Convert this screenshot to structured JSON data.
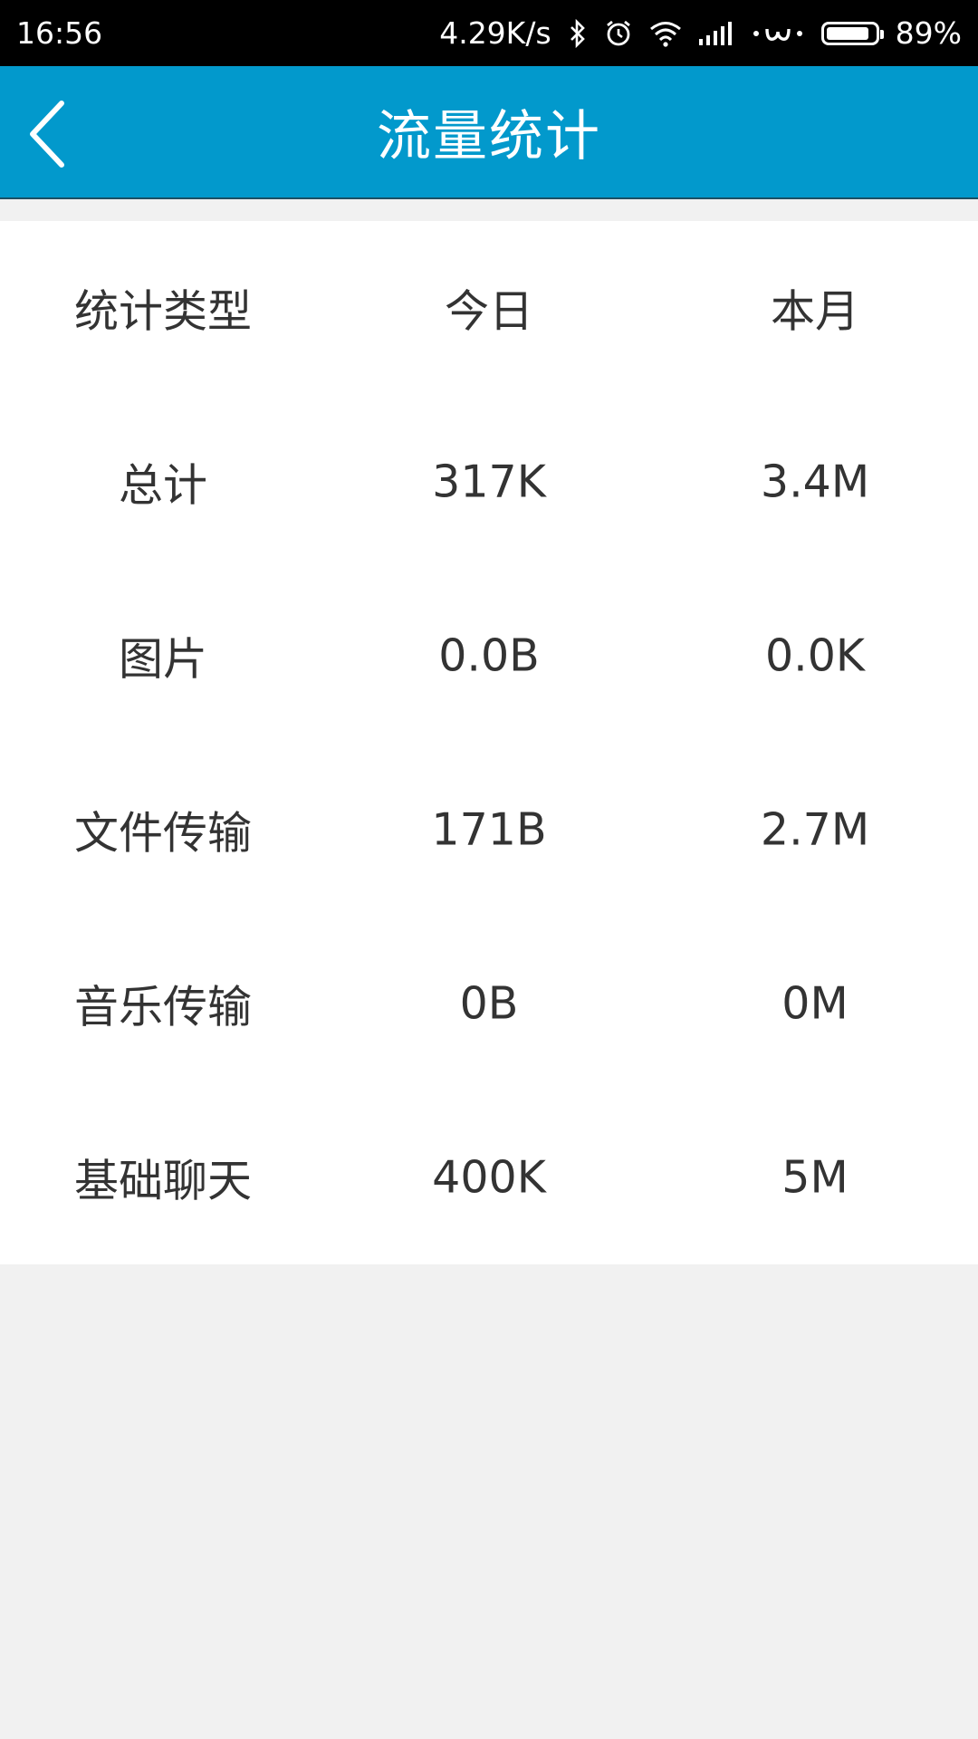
{
  "status_bar": {
    "time": "16:56",
    "speed": "4.29K/s",
    "battery": "89%",
    "battery_level": 0.89,
    "icons": [
      "bluetooth-icon",
      "alarm-icon",
      "wifi-icon",
      "signal-icon",
      "weibo-icon",
      "battery-icon"
    ]
  },
  "header": {
    "title": "流量统计",
    "back_icon": "chevron-left-icon",
    "bar_color": "#0299cc"
  },
  "table": {
    "headers": [
      "统计类型",
      "今日",
      "本月"
    ],
    "rows": [
      [
        "总计",
        "317K",
        "3.4M"
      ],
      [
        "图片",
        "0.0B",
        "0.0K"
      ],
      [
        "文件传输",
        "171B",
        "2.7M"
      ],
      [
        "音乐传输",
        "0B",
        "0M"
      ],
      [
        "基础聊天",
        "400K",
        "5M"
      ]
    ]
  }
}
